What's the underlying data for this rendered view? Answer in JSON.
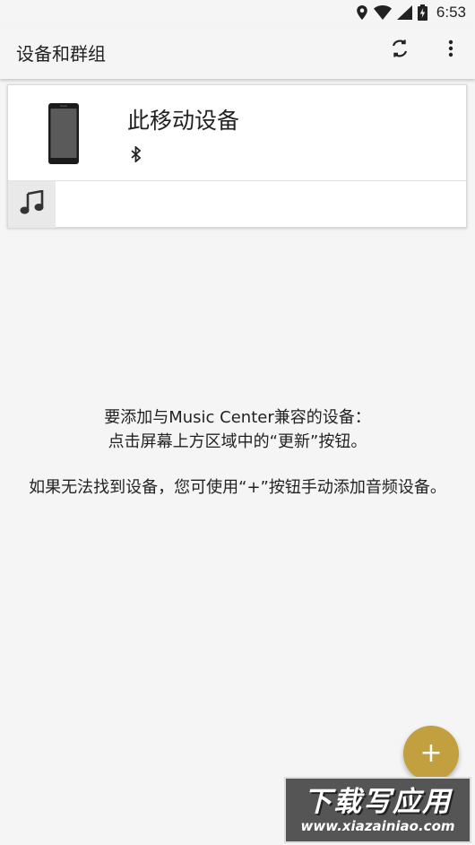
{
  "status_bar": {
    "time": "6:53",
    "icons": [
      "location-icon",
      "wifi-icon",
      "signal-icon",
      "battery-charging-icon"
    ]
  },
  "app_bar": {
    "title": "设备和群组",
    "actions": [
      "refresh-icon",
      "more-vert-icon"
    ]
  },
  "device_card": {
    "name": "此移动设备",
    "connection_icon": "bluetooth-icon",
    "device_icon": "smartphone-icon",
    "tab_icon": "music-note-icon"
  },
  "empty_state": {
    "line1": "要添加与Music Center兼容的设备：",
    "line2": "点击屏幕上方区域中的“更新”按钮。",
    "line3": "如果无法找到设备，您可使用“+”按钮手动添加音频设备。"
  },
  "fab": {
    "label": "+"
  },
  "watermark": {
    "text": "下载写应用",
    "url": "www.xiazainiao.com"
  },
  "colors": {
    "accent": "#c2a040",
    "background": "#f5f5f5"
  }
}
